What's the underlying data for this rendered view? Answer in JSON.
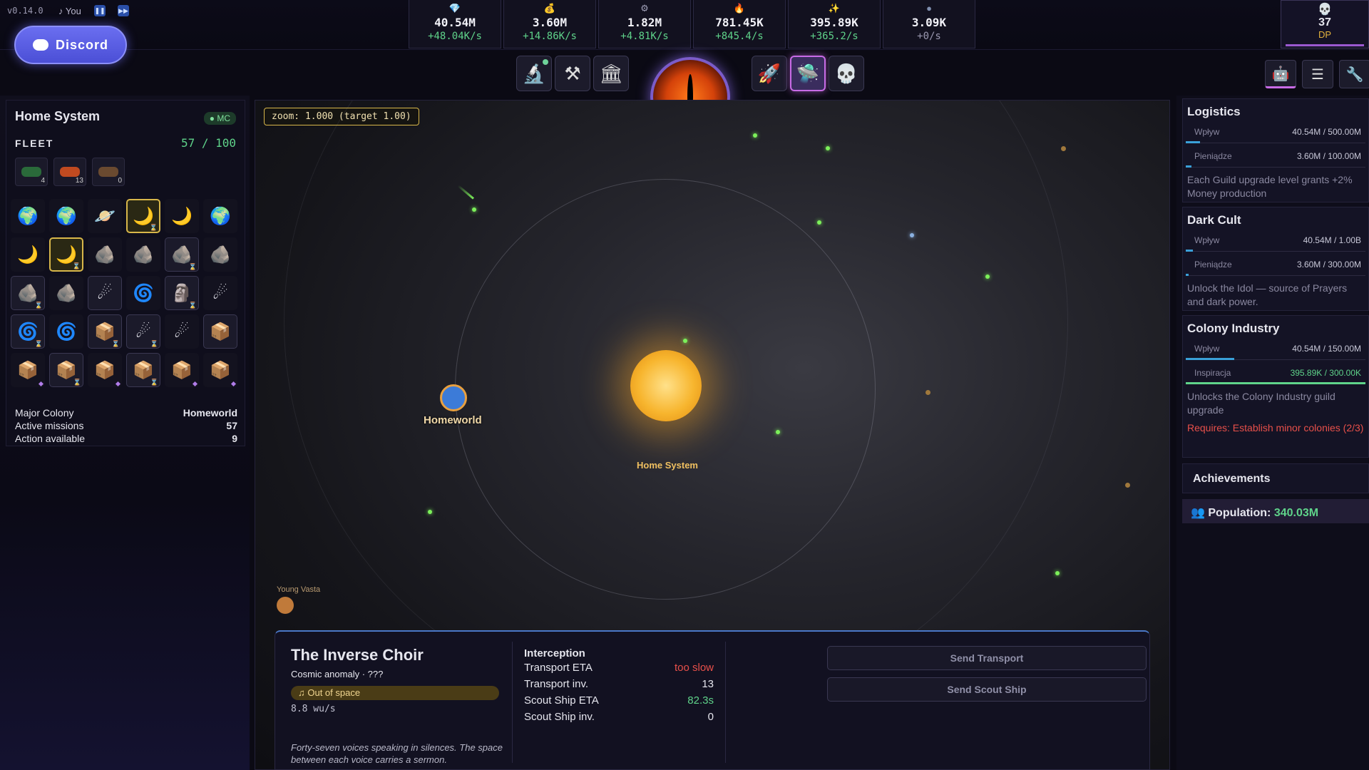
{
  "version": "v0.14.0",
  "music": "♪ You",
  "discord": {
    "label": "Discord"
  },
  "resources": [
    {
      "icon": "💎",
      "value": "40.54M",
      "rate": "+48.04K/s",
      "color": "#4aa8f0"
    },
    {
      "icon": "💰",
      "value": "3.60M",
      "rate": "+14.86K/s",
      "color": "#e0a040"
    },
    {
      "icon": "⚙",
      "value": "1.82M",
      "rate": "+4.81K/s",
      "color": "#a0a0b8"
    },
    {
      "icon": "🔥",
      "value": "781.45K",
      "rate": "+845.4/s",
      "color": "#f08030"
    },
    {
      "icon": "✨",
      "value": "395.89K",
      "rate": "+365.2/s",
      "color": "#f0d050"
    },
    {
      "icon": "●",
      "value": "3.09K",
      "rate": "+0/s",
      "color": "#8090b0"
    }
  ],
  "dp": {
    "value": "37",
    "label": "DP"
  },
  "left": {
    "title": "Home System",
    "badge": "● MC",
    "fleet_label": "FLEET",
    "fleet_count": "57 / 100",
    "ships": [
      "4",
      "13",
      "0"
    ],
    "stats": [
      {
        "label": "Major Colony",
        "value": "Homeworld"
      },
      {
        "label": "Active missions",
        "value": "57"
      },
      {
        "label": "Action available",
        "value": "9"
      }
    ]
  },
  "map": {
    "zoom": "zoom: 1.000 (target 1.00)",
    "sun_label": "Home System",
    "homeworld_label": "Homeworld",
    "young_label": "Young Vasta"
  },
  "info": {
    "name": "The Inverse Choir",
    "subtitle": "Cosmic anomaly · ???",
    "pill": "♫ Out of space",
    "speed": "8.8 wu/s",
    "description": "Forty-seven voices speaking in silences. The space between each voice carries a sermon.",
    "interception": {
      "title": "Interception",
      "rows": [
        {
          "label": "Transport ETA",
          "value": "too slow"
        },
        {
          "label": "Transport inv.",
          "value": "13"
        },
        {
          "label": "Scout Ship ETA",
          "value": "82.3s"
        },
        {
          "label": "Scout Ship inv.",
          "value": "0"
        }
      ]
    },
    "send_transport": "Send Transport",
    "send_scout": "Send Scout Ship"
  },
  "guilds": [
    {
      "title": "Logistics",
      "bars": [
        {
          "label": "Wpływ",
          "value": "40.54M / 500.00M",
          "progress": 0.081
        },
        {
          "label": "Pieniądze",
          "value": "3.60M / 100.00M",
          "progress": 0.036
        }
      ],
      "desc": "Each Guild upgrade level grants +2% Money production"
    },
    {
      "title": "Dark Cult",
      "bars": [
        {
          "label": "Wpływ",
          "value": "40.54M / 1.00B",
          "progress": 0.041
        },
        {
          "label": "Pieniądze",
          "value": "3.60M / 300.00M",
          "progress": 0.012
        }
      ],
      "desc": "Unlock the Idol — source of Prayers and dark power."
    },
    {
      "title": "Colony Industry",
      "bars": [
        {
          "label": "Wpływ",
          "value": "40.54M / 150.00M",
          "progress": 0.27
        },
        {
          "label": "Inspiracja",
          "value": "395.89K / 300.00K",
          "progress": 1.0
        }
      ],
      "desc": "Unlocks the Colony Industry guild upgrade",
      "req": "Requires: Establish minor colonies (2/3)"
    }
  ],
  "achievements": "Achievements",
  "population": {
    "label": "Population:",
    "value": "340.03M"
  }
}
